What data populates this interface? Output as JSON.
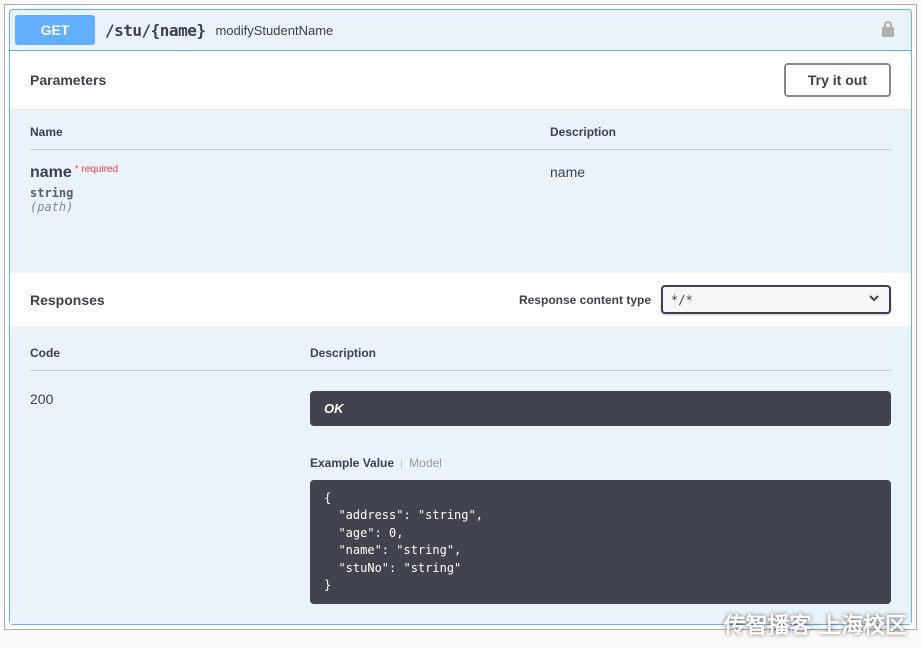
{
  "summary": {
    "method": "GET",
    "path": "/stu/{name}",
    "description": "modifyStudentName"
  },
  "sections": {
    "parameters_title": "Parameters",
    "tryout_label": "Try it out",
    "responses_title": "Responses",
    "content_type_label": "Response content type",
    "content_type_value": "*/*"
  },
  "param_headers": {
    "name": "Name",
    "description": "Description"
  },
  "parameters": [
    {
      "name": "name",
      "required_label": "* required",
      "type": "string",
      "in": "(path)",
      "description": "name"
    }
  ],
  "resp_headers": {
    "code": "Code",
    "description": "Description"
  },
  "responses": [
    {
      "code": "200",
      "description": "OK",
      "tabs": {
        "example": "Example Value",
        "model": "Model"
      },
      "example": "{\n  \"address\": \"string\",\n  \"age\": 0,\n  \"name\": \"string\",\n  \"stuNo\": \"string\"\n}"
    }
  ],
  "watermark": "传智播客-上海校区"
}
